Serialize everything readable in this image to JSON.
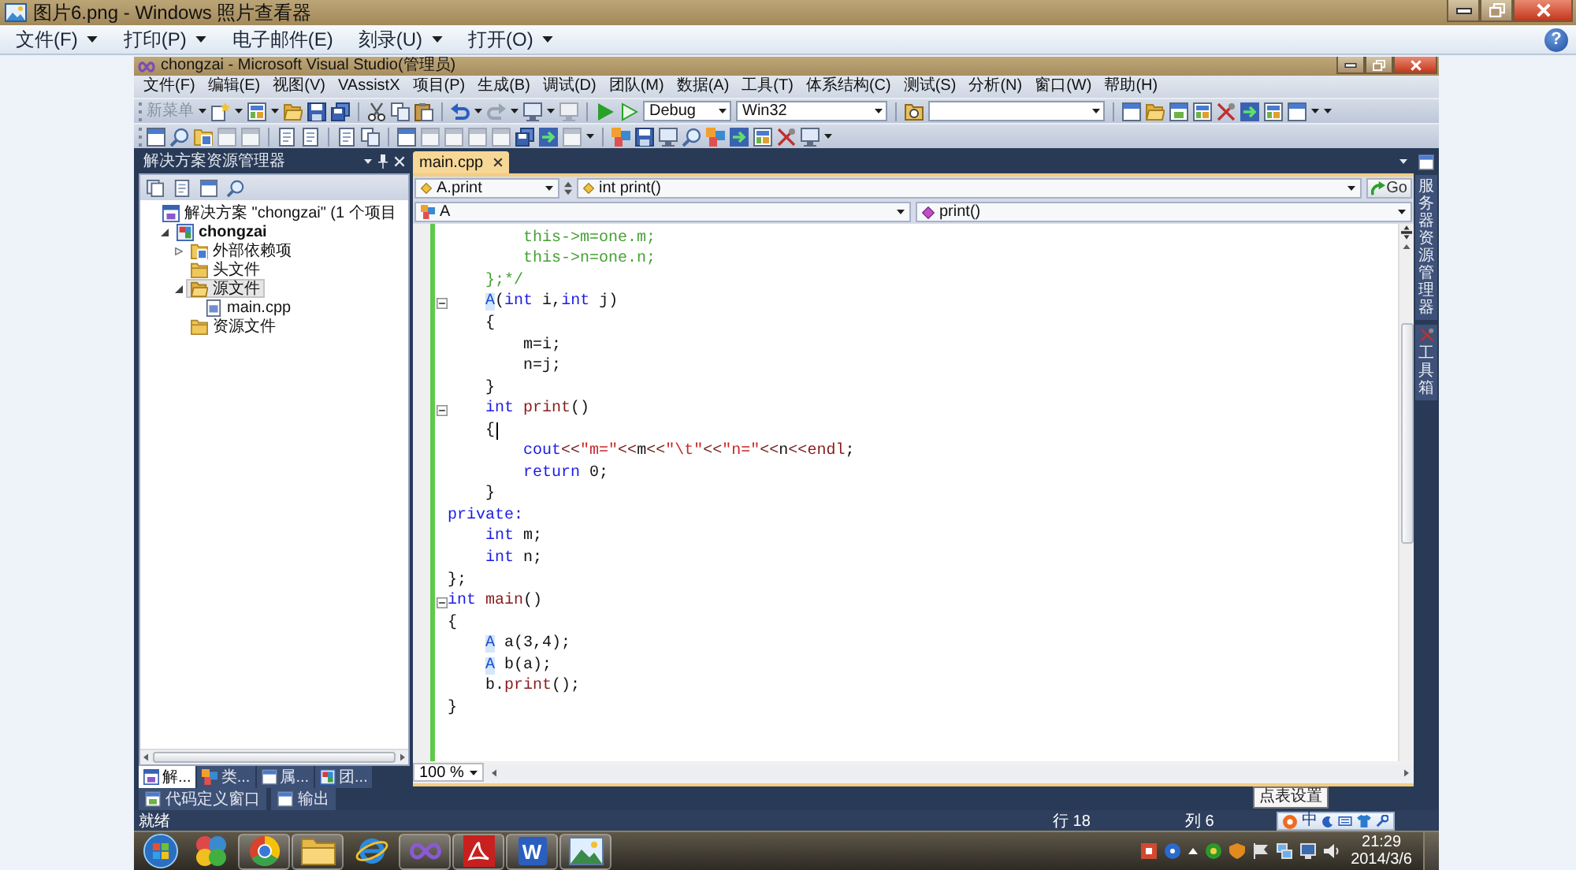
{
  "viewer": {
    "title": "图片6.png - Windows 照片查看器",
    "menu": [
      {
        "label": "文件(F)",
        "dropdown": true
      },
      {
        "label": "打印(P)",
        "dropdown": true
      },
      {
        "label": "电子邮件(E)",
        "dropdown": false
      },
      {
        "label": "刻录(U)",
        "dropdown": true
      },
      {
        "label": "打开(O)",
        "dropdown": true
      }
    ],
    "help": "?"
  },
  "vs": {
    "title": "chongzai - Microsoft Visual Studio(管理员)",
    "menu": [
      "文件(F)",
      "编辑(E)",
      "视图(V)",
      "VAssistX",
      "项目(P)",
      "生成(B)",
      "调试(D)",
      "团队(M)",
      "数据(A)",
      "工具(T)",
      "体系结构(C)",
      "测试(S)",
      "分析(N)",
      "窗口(W)",
      "帮助(H)"
    ],
    "toolbar": {
      "new_menu": {
        "label": "新菜单",
        "disabled": true
      },
      "configuration": "Debug",
      "platform": "Win32"
    },
    "solution_explorer": {
      "title": "解决方案资源管理器",
      "tree": [
        {
          "label": "解决方案 \"chongzai\" (1 个项目",
          "kind": "solution",
          "selected": false,
          "children": [
            {
              "label": "chongzai",
              "kind": "project",
              "expanded": true,
              "selected": false,
              "children": [
                {
                  "label": "外部依赖项",
                  "kind": "dependencies",
                  "expanded": false,
                  "selected": false
                },
                {
                  "label": "头文件",
                  "kind": "folder",
                  "selected": false
                },
                {
                  "label": "源文件",
                  "kind": "folder",
                  "expanded": true,
                  "selected": true,
                  "children": [
                    {
                      "label": "main.cpp",
                      "kind": "file",
                      "selected": false
                    }
                  ]
                },
                {
                  "label": "资源文件",
                  "kind": "folder",
                  "selected": false
                }
              ]
            }
          ]
        }
      ],
      "tabs": [
        {
          "label": "解...",
          "selected": true
        },
        {
          "label": "类...",
          "selected": false
        },
        {
          "label": "属...",
          "selected": false
        },
        {
          "label": "团...",
          "selected": false
        }
      ]
    },
    "editor": {
      "tabs": [
        {
          "label": "main.cpp",
          "selected": true
        }
      ],
      "navigation": {
        "scope": "A.print",
        "member": "int print()",
        "go": "Go",
        "class": "A",
        "method": "print()"
      },
      "lines": [
        {
          "fold": false,
          "caret": false,
          "tokens": [
            {
              "text": "        this->m=one.m;",
              "kind": "comment"
            }
          ]
        },
        {
          "fold": false,
          "caret": false,
          "tokens": [
            {
              "text": "        this->n=one.n;",
              "kind": "comment"
            }
          ]
        },
        {
          "fold": false,
          "caret": false,
          "tokens": [
            {
              "text": "    };*/",
              "kind": "comment"
            }
          ]
        },
        {
          "fold": true,
          "caret": false,
          "tokens": [
            {
              "text": "    A",
              "kind": "class"
            },
            {
              "text": "(",
              "kind": "plain"
            },
            {
              "text": "int",
              "kind": "keyword"
            },
            {
              "text": " i,",
              "kind": "plain"
            },
            {
              "text": "int",
              "kind": "keyword"
            },
            {
              "text": " j)",
              "kind": "plain"
            }
          ]
        },
        {
          "fold": false,
          "caret": false,
          "tokens": [
            {
              "text": "    {",
              "kind": "plain"
            }
          ]
        },
        {
          "fold": false,
          "caret": false,
          "tokens": [
            {
              "text": "        m=i;",
              "kind": "plain"
            }
          ]
        },
        {
          "fold": false,
          "caret": false,
          "tokens": [
            {
              "text": "        n=j;",
              "kind": "plain"
            }
          ]
        },
        {
          "fold": false,
          "caret": false,
          "tokens": [
            {
              "text": "    }",
              "kind": "plain"
            }
          ]
        },
        {
          "fold": true,
          "caret": false,
          "tokens": [
            {
              "text": "    int",
              "kind": "keyword"
            },
            {
              "text": " print",
              "kind": "method"
            },
            {
              "text": "()",
              "kind": "plain"
            }
          ]
        },
        {
          "fold": false,
          "caret": true,
          "tokens": [
            {
              "text": "    {",
              "kind": "plain"
            }
          ]
        },
        {
          "fold": false,
          "caret": false,
          "tokens": [
            {
              "text": "        cout",
              "kind": "keyword"
            },
            {
              "text": "<<",
              "kind": "op"
            },
            {
              "text": "\"m=\"",
              "kind": "string"
            },
            {
              "text": "<<",
              "kind": "op"
            },
            {
              "text": "m",
              "kind": "plain"
            },
            {
              "text": "<<",
              "kind": "op"
            },
            {
              "text": "\"\\t\"",
              "kind": "string"
            },
            {
              "text": "<<",
              "kind": "op"
            },
            {
              "text": "\"n=\"",
              "kind": "string"
            },
            {
              "text": "<<",
              "kind": "op"
            },
            {
              "text": "n",
              "kind": "plain"
            },
            {
              "text": "<<",
              "kind": "op"
            },
            {
              "text": "endl",
              "kind": "method"
            },
            {
              "text": ";",
              "kind": "plain"
            }
          ]
        },
        {
          "fold": false,
          "caret": false,
          "tokens": [
            {
              "text": "        return",
              "kind": "keyword"
            },
            {
              "text": " 0;",
              "kind": "plain"
            }
          ]
        },
        {
          "fold": false,
          "caret": false,
          "tokens": [
            {
              "text": "    }",
              "kind": "plain"
            }
          ]
        },
        {
          "fold": false,
          "caret": false,
          "tokens": [
            {
              "text": "private:",
              "kind": "keyword"
            }
          ]
        },
        {
          "fold": false,
          "caret": false,
          "tokens": [
            {
              "text": "    int",
              "kind": "keyword"
            },
            {
              "text": " m;",
              "kind": "plain"
            }
          ]
        },
        {
          "fold": false,
          "caret": false,
          "tokens": [
            {
              "text": "    int",
              "kind": "keyword"
            },
            {
              "text": " n;",
              "kind": "plain"
            }
          ]
        },
        {
          "fold": false,
          "caret": false,
          "tokens": [
            {
              "text": "};",
              "kind": "plain"
            }
          ]
        },
        {
          "fold": true,
          "caret": false,
          "tokens": [
            {
              "text": "int",
              "kind": "keyword"
            },
            {
              "text": " main",
              "kind": "method"
            },
            {
              "text": "()",
              "kind": "plain"
            }
          ]
        },
        {
          "fold": false,
          "caret": false,
          "tokens": [
            {
              "text": "{",
              "kind": "plain"
            }
          ]
        },
        {
          "fold": false,
          "caret": false,
          "tokens": [
            {
              "text": "    A",
              "kind": "class"
            },
            {
              "text": " a(3,4);",
              "kind": "plain"
            }
          ]
        },
        {
          "fold": false,
          "caret": false,
          "tokens": [
            {
              "text": "    A",
              "kind": "class"
            },
            {
              "text": " b(a);",
              "kind": "plain"
            }
          ]
        },
        {
          "fold": false,
          "caret": false,
          "tokens": [
            {
              "text": "    b.",
              "kind": "plain"
            },
            {
              "text": "print",
              "kind": "method"
            },
            {
              "text": "();",
              "kind": "plain"
            }
          ]
        },
        {
          "fold": false,
          "caret": false,
          "tokens": [
            {
              "text": "}",
              "kind": "plain"
            }
          ]
        }
      ],
      "zoom": "100 %"
    },
    "side_tabs": [
      "服务器资源管理器",
      "工具箱"
    ],
    "bottom_tabs": [
      "代码定义窗口",
      "输出"
    ],
    "status": {
      "message": "就绪",
      "line": "行 18",
      "column": "列 6"
    }
  },
  "tooltip": "点表设置",
  "ime_toolbar": {
    "mode": "中"
  },
  "taskbar": {
    "apps": [
      {
        "kind": "pinwheel",
        "running": false
      },
      {
        "kind": "colorwheel",
        "running": true
      },
      {
        "kind": "folder",
        "running": true
      },
      {
        "kind": "orbit",
        "running": false
      },
      {
        "kind": "infinity",
        "running": true
      },
      {
        "kind": "swirl",
        "running": true
      },
      {
        "kind": "letter",
        "label": "W",
        "running": true
      },
      {
        "kind": "picture",
        "running": true
      }
    ],
    "time": "21:29",
    "date": "2014/3/6"
  }
}
